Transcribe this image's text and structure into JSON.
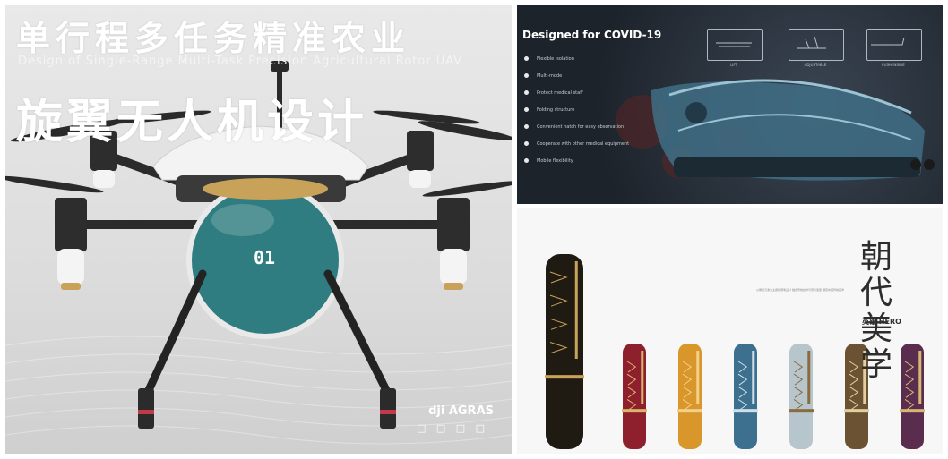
{
  "drone_panel": {
    "title_line1": "单行程多任务精准农业",
    "subtitle_en": "Design of Single-Range Multi-Task Precision Agricultural Rotor UAV",
    "title_line2": "旋翼无人机设计",
    "badge_number": "01",
    "logo_text": "dji",
    "logo_sub": "AGRAS",
    "logo_sub2": "□ □ □ □",
    "colors": {
      "body": "#f2f2f2",
      "dome": "#2f7d80",
      "arm": "#2b2b2b",
      "accent": "#c9a25a"
    }
  },
  "covid_panel": {
    "title": "Designed for COVID-19",
    "bullets": [
      "Flexible isolation",
      "Multi-mode",
      "Protect medical staff",
      "Folding structure",
      "Convenient hatch for easy observation",
      "Cooperate with other medical equipment",
      "Mobile flexibility"
    ],
    "modes": [
      "LIFT",
      "ADJUSTABLE",
      "PUSH INSIDE"
    ],
    "colors": {
      "background": "#1d232b",
      "pod": "#3f6f86"
    }
  },
  "pen_panel": {
    "title": "朝代美学",
    "brand": "英雄 HERO",
    "description": "以朝代元素为主题的钢笔设计 融合传统纹样与现代造型 展现中国传统美学",
    "pens": [
      {
        "color": "#1f1a12",
        "accent": "#c9a35a"
      },
      {
        "color": "#8e1f2c",
        "accent": "#d9b56e"
      },
      {
        "color": "#d9962a",
        "accent": "#f2d08a"
      },
      {
        "color": "#3d6f8f",
        "accent": "#cfe0ea"
      },
      {
        "color": "#b7c6cc",
        "accent": "#8a6b3f"
      },
      {
        "color": "#6b5232",
        "accent": "#e2cfa0"
      },
      {
        "color": "#5a2c4e",
        "accent": "#d7b872"
      }
    ]
  }
}
